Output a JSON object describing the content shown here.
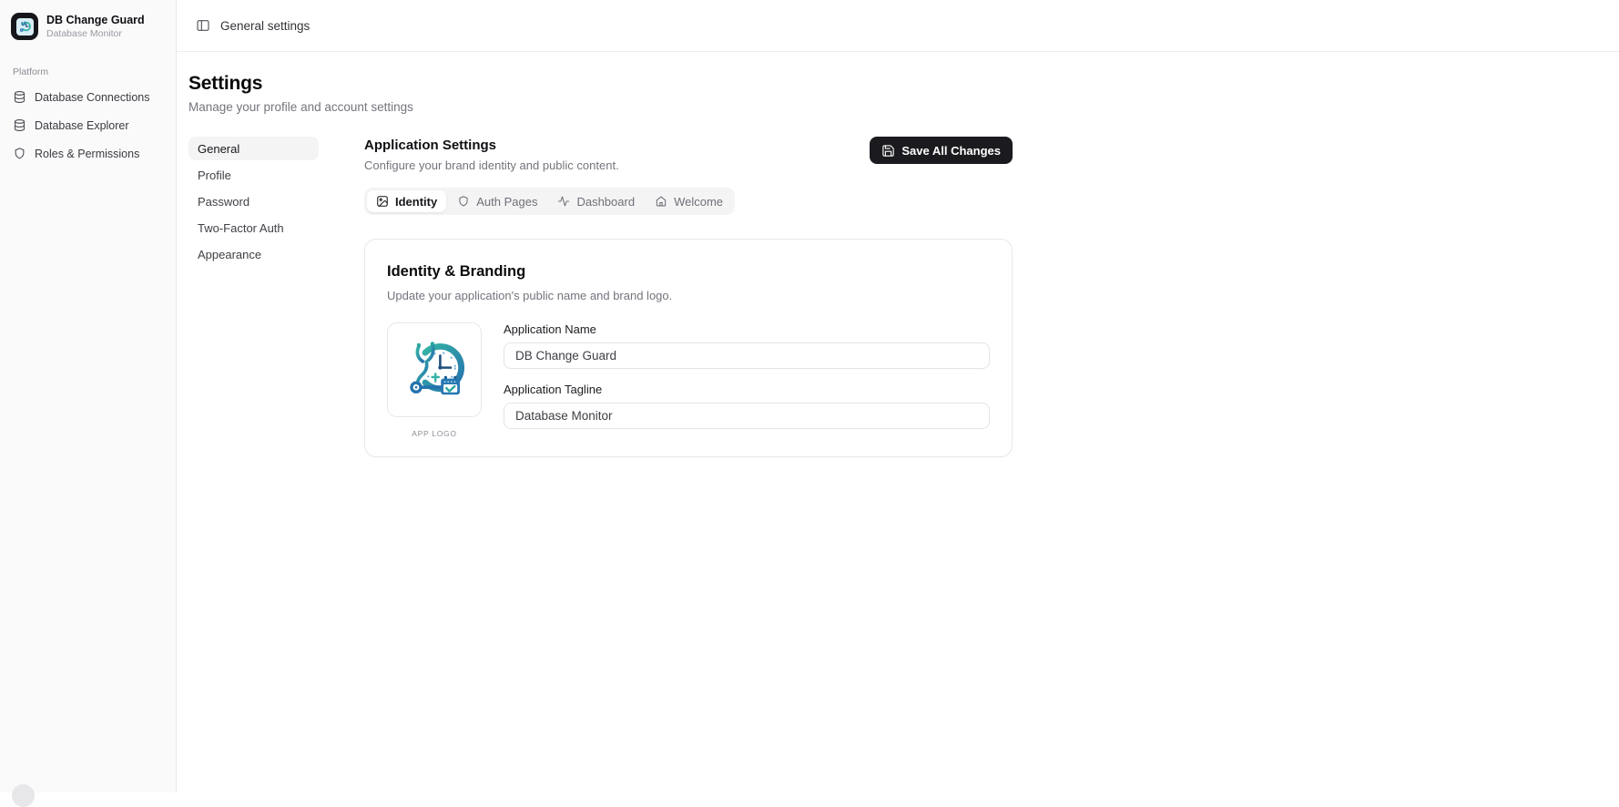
{
  "brand": {
    "name": "DB Change Guard",
    "tagline": "Database Monitor"
  },
  "sidebar": {
    "section_label": "Platform",
    "items": [
      {
        "label": "Database Connections",
        "icon": "database-icon"
      },
      {
        "label": "Database Explorer",
        "icon": "database-icon"
      },
      {
        "label": "Roles & Permissions",
        "icon": "shield-icon"
      }
    ]
  },
  "topbar": {
    "breadcrumb": "General settings",
    "icon": "panel-left-icon"
  },
  "page": {
    "title": "Settings",
    "subtitle": "Manage your profile and account settings"
  },
  "settings_nav": {
    "items": [
      {
        "label": "General",
        "active": true
      },
      {
        "label": "Profile",
        "active": false
      },
      {
        "label": "Password",
        "active": false
      },
      {
        "label": "Two-Factor Auth",
        "active": false
      },
      {
        "label": "Appearance",
        "active": false
      }
    ]
  },
  "section": {
    "title": "Application Settings",
    "subtitle": "Configure your brand identity and public content.",
    "save_label": "Save All Changes",
    "save_icon": "save-icon"
  },
  "tabs": [
    {
      "label": "Identity",
      "icon": "image-icon",
      "active": true
    },
    {
      "label": "Auth Pages",
      "icon": "shield-icon",
      "active": false
    },
    {
      "label": "Dashboard",
      "icon": "activity-icon",
      "active": false
    },
    {
      "label": "Welcome",
      "icon": "home-icon",
      "active": false
    }
  ],
  "card": {
    "title": "Identity & Branding",
    "subtitle": "Update your application's public name and brand logo.",
    "logo_caption": "APP LOGO",
    "fields": [
      {
        "label": "Application Name",
        "value": "DB Change Guard"
      },
      {
        "label": "Application Tagline",
        "value": "Database Monitor"
      }
    ]
  },
  "colors": {
    "button_dark": "#1b1b1f",
    "active_pill_bg": "#f4f4f5",
    "logo_teal": "#35b3a5",
    "logo_blue": "#2472ae"
  }
}
